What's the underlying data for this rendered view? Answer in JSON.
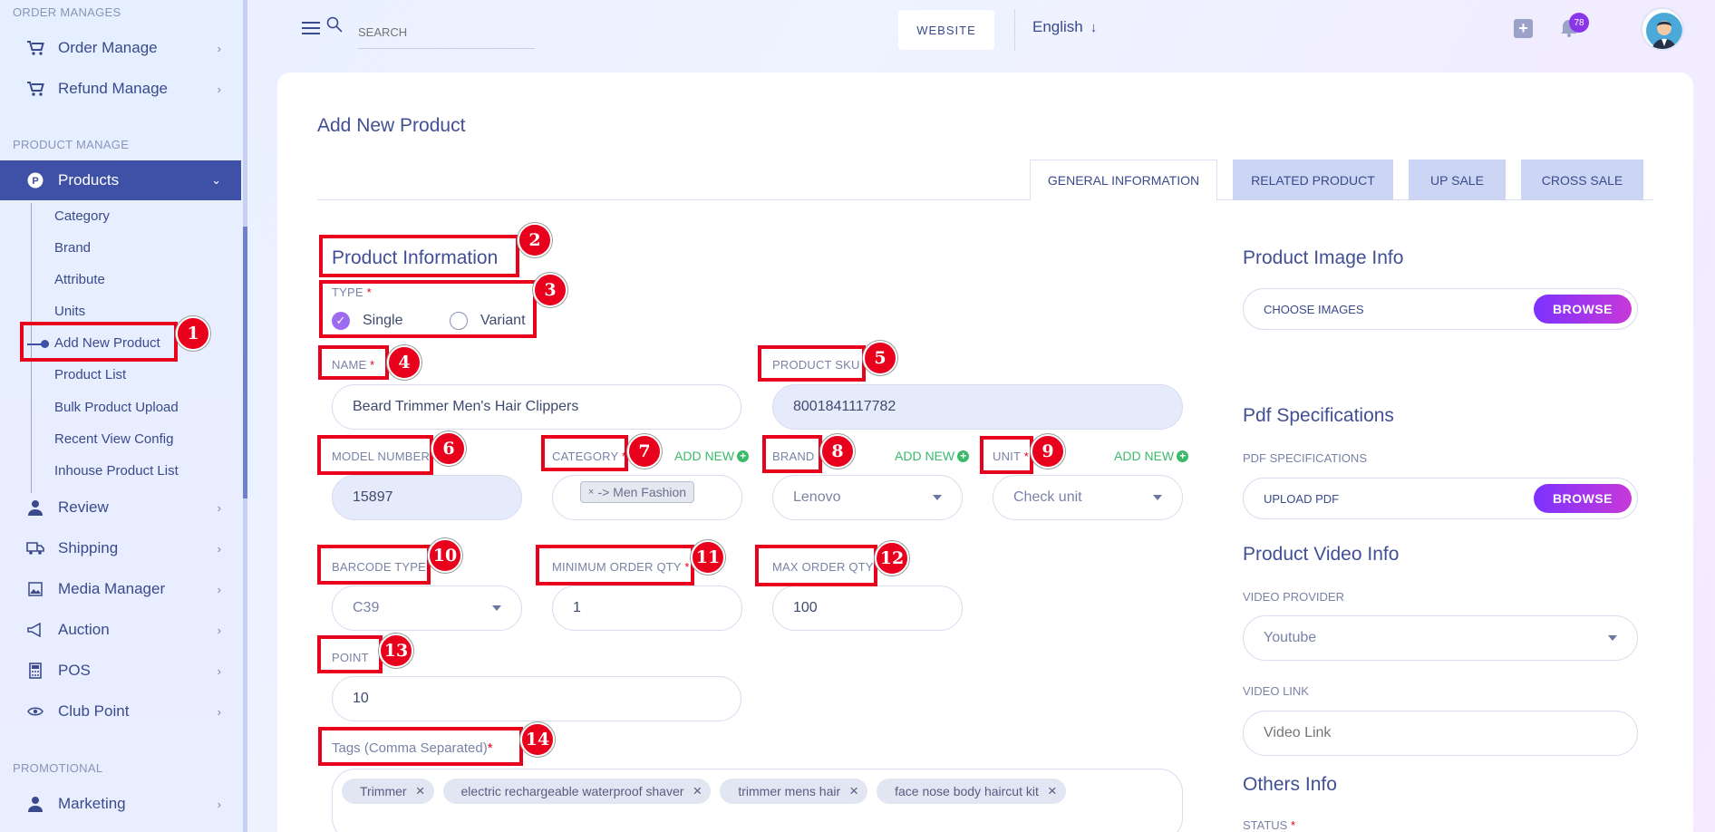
{
  "sidebar": {
    "sections": {
      "order": "ORDER MANAGES",
      "product": "PRODUCT MANAGE",
      "promotional": "PROMOTIONAL"
    },
    "items": {
      "order_manage": "Order Manage",
      "refund_manage": "Refund Manage",
      "products": "Products",
      "review": "Review",
      "shipping": "Shipping",
      "media_manager": "Media Manager",
      "auction": "Auction",
      "pos": "POS",
      "club_point": "Club Point",
      "marketing": "Marketing"
    },
    "sub": {
      "category": "Category",
      "brand": "Brand",
      "attribute": "Attribute",
      "units": "Units",
      "add_new_product": "Add New Product",
      "product_list": "Product List",
      "bulk_upload": "Bulk Product Upload",
      "recent_view": "Recent View Config",
      "inhouse": "Inhouse Product List"
    }
  },
  "topbar": {
    "search_placeholder": "SEARCH",
    "website": "WEBSITE",
    "language": "English",
    "notification_count": "78"
  },
  "page": {
    "title": "Add New Product"
  },
  "tabs": {
    "general": "GENERAL INFORMATION",
    "related": "RELATED PRODUCT",
    "upsale": "UP SALE",
    "crosssale": "CROSS SALE"
  },
  "form": {
    "section_title": "Product Information",
    "type_label": "TYPE",
    "type_single": "Single",
    "type_variant": "Variant",
    "name_label": "NAME",
    "name_value": "Beard Trimmer Men's Hair Clippers",
    "sku_label": "PRODUCT SKU",
    "sku_value": "8001841117782",
    "model_label": "MODEL NUMBER",
    "model_value": "15897",
    "category_label": "CATEGORY",
    "category_chip": "-> Men Fashion",
    "add_new": "ADD NEW",
    "brand_label": "BRAND",
    "brand_value": "Lenovo",
    "unit_label": "UNIT",
    "unit_placeholder": "Check unit",
    "barcode_label": "BARCODE TYPE",
    "barcode_value": "C39",
    "min_qty_label": "MINIMUM ORDER QTY",
    "min_qty_value": "1",
    "max_qty_label": "MAX ORDER QTY",
    "max_qty_value": "100",
    "point_label": "POINT",
    "point_value": "10",
    "tags_label": "Tags (Comma Separated)",
    "tags": [
      "Trimmer",
      "electric rechargeable waterproof shaver",
      "trimmer mens hair",
      "face nose body haircut kit"
    ],
    "required_mark": "*"
  },
  "right": {
    "image_title": "Product Image Info",
    "choose_images": "CHOOSE IMAGES",
    "browse": "BROWSE",
    "pdf_title": "Pdf Specifications",
    "pdf_label": "PDF SPECIFICATIONS",
    "upload_pdf": "UPLOAD PDF",
    "video_title": "Product Video Info",
    "video_provider_label": "VIDEO PROVIDER",
    "video_provider_value": "Youtube",
    "video_link_label": "VIDEO LINK",
    "video_link_placeholder": "Video Link",
    "others_title": "Others Info",
    "status_label": "STATUS"
  },
  "annotations": [
    "1",
    "2",
    "3",
    "4",
    "5",
    "6",
    "7",
    "8",
    "9",
    "10",
    "11",
    "12",
    "13",
    "14"
  ],
  "colors": {
    "accent": "#3f51a6",
    "highlight": "#e8001c",
    "add_new": "#3bba6a",
    "browse_start": "#7c32ff",
    "browse_end": "#c738d8"
  }
}
